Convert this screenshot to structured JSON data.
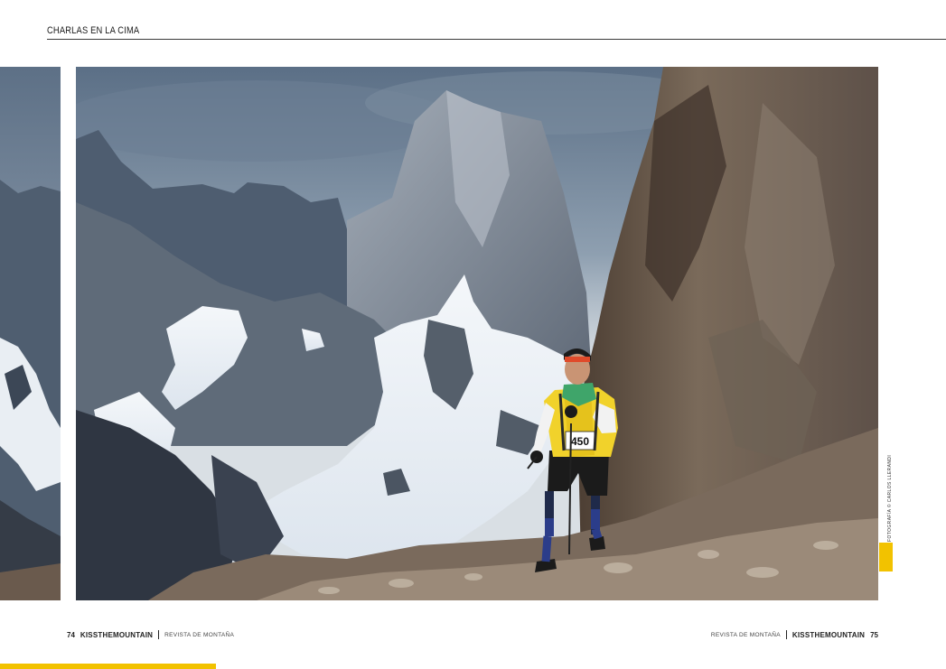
{
  "header": {
    "section_title": "CHARLAS EN LA CIMA"
  },
  "photo": {
    "credit": "FOTOGRAFÍA © CARLOS LLERANDI",
    "bib_number": "450",
    "description_icon": "mountain-runner-photo"
  },
  "footer_left": {
    "page_number": "74",
    "brand": "KISSTHEMOUNTAIN",
    "magazine": "REVISTA DE MONTAÑA"
  },
  "footer_right": {
    "page_number": "75",
    "brand": "KISSTHEMOUNTAIN",
    "magazine": "REVISTA DE MONTAÑA"
  },
  "colors": {
    "accent_yellow": "#f2c200",
    "rule": "#3a3a3a"
  }
}
